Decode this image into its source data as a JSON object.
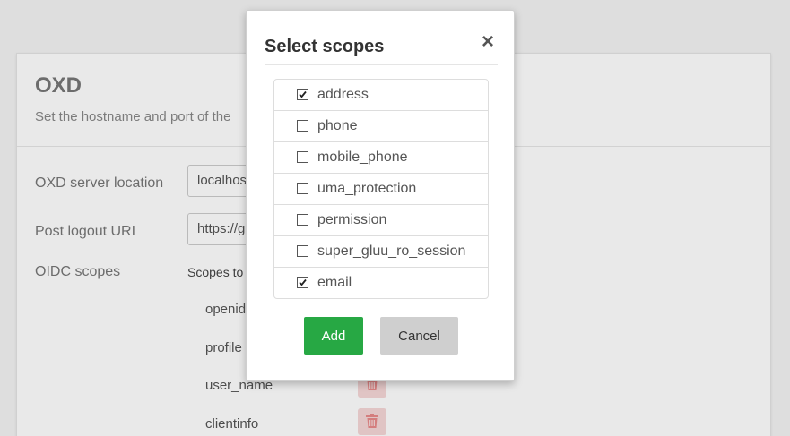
{
  "background_page": {
    "panel": {
      "title": "OXD",
      "description": "Set the hostname and port of the"
    },
    "fields": [
      {
        "label": "OXD server location",
        "value": "localhost"
      },
      {
        "label": "Post logout URI",
        "value": "https://g"
      }
    ],
    "oidc": {
      "label": "OIDC scopes",
      "hint": "Scopes to",
      "items": [
        "openid",
        "profile",
        "user_name",
        "clientinfo"
      ]
    }
  },
  "modal": {
    "title": "Select scopes",
    "close_glyph": "×",
    "scopes": [
      {
        "label": "address",
        "checked": true
      },
      {
        "label": "phone",
        "checked": false
      },
      {
        "label": "mobile_phone",
        "checked": false
      },
      {
        "label": "uma_protection",
        "checked": false
      },
      {
        "label": "permission",
        "checked": false
      },
      {
        "label": "super_gluu_ro_session",
        "checked": false
      },
      {
        "label": "email",
        "checked": true
      }
    ],
    "add_label": "Add",
    "cancel_label": "Cancel"
  },
  "colors": {
    "add_button": "#27a844",
    "cancel_button": "#cfcfcf",
    "trash_button_bg": "#f6d7d7",
    "trash_icon": "#e88a8a"
  },
  "icons": {
    "trash": "trash-icon",
    "check": "check-icon",
    "close": "close-icon"
  }
}
